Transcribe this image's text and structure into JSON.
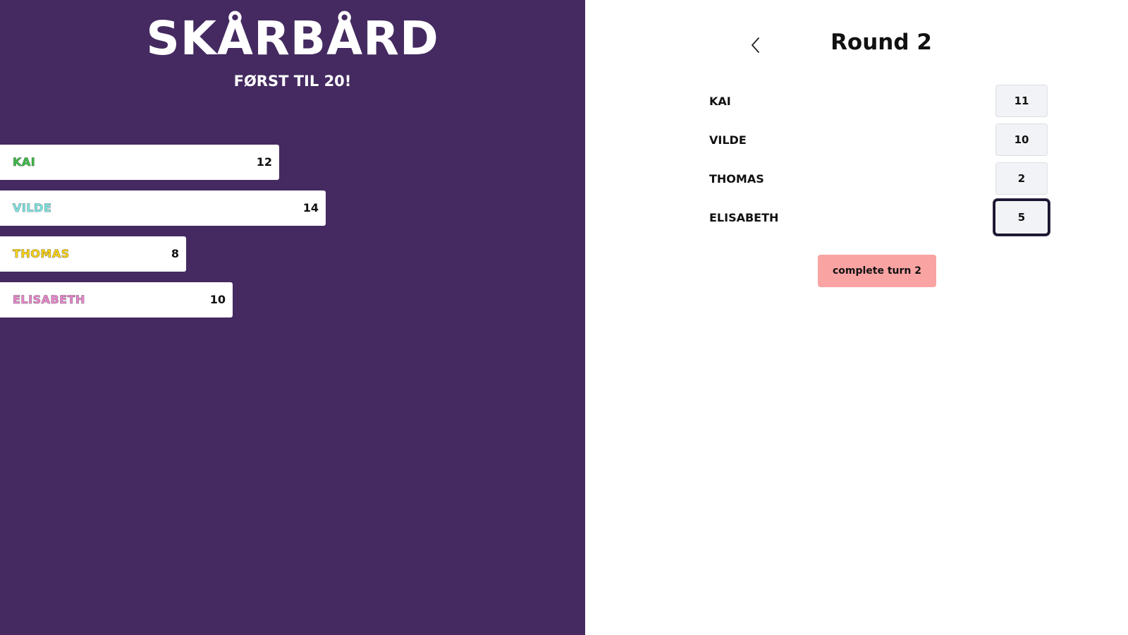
{
  "scoreboard": {
    "title": "SKÅRBÅRD",
    "subtitle": "FØRST TIL 20!",
    "goal": 20,
    "players": [
      {
        "name": "KAI",
        "score": 12,
        "color": "#3fb84a"
      },
      {
        "name": "VILDE",
        "score": 14,
        "color": "#7fe3e0"
      },
      {
        "name": "THOMAS",
        "score": 8,
        "color": "#f4cf16"
      },
      {
        "name": "ELISABETH",
        "score": 10,
        "color": "#e585c9"
      }
    ]
  },
  "round": {
    "back_icon": "chevron-left-icon",
    "title": "Round 2",
    "entries": [
      {
        "name": "KAI",
        "value": "11"
      },
      {
        "name": "VILDE",
        "value": "10"
      },
      {
        "name": "THOMAS",
        "value": "2"
      },
      {
        "name": "ELISABETH",
        "value": "5"
      }
    ],
    "complete_label": "complete turn 2"
  },
  "colors": {
    "left_background": "#442a60",
    "button_background": "#f9a3a3"
  }
}
